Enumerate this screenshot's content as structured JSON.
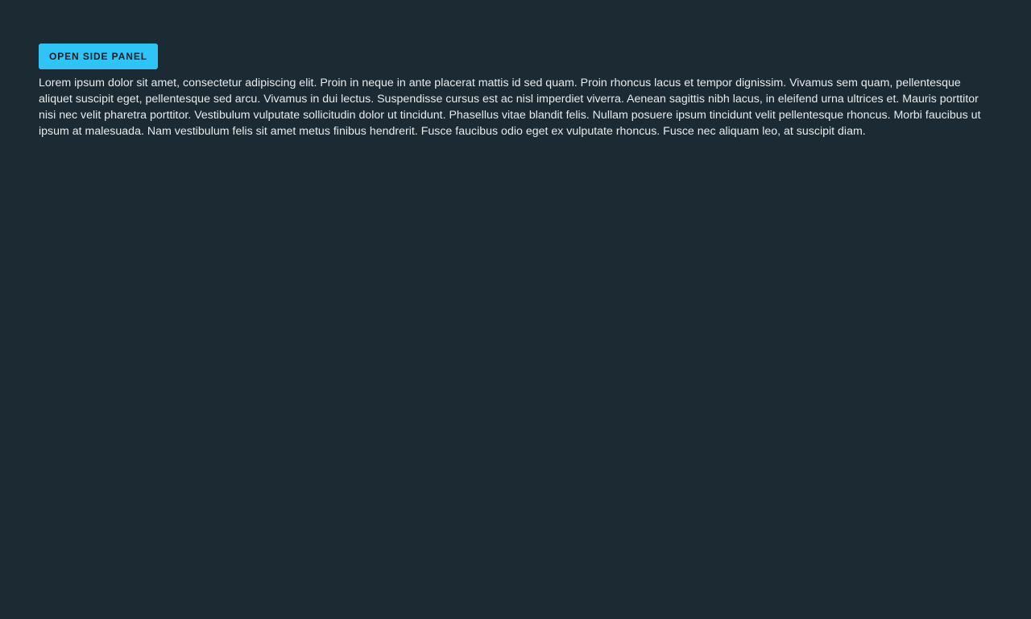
{
  "main": {
    "open_panel_button_label": "OPEN SIDE PANEL",
    "paragraph": "Lorem ipsum dolor sit amet, consectetur adipiscing elit. Proin in neque in ante placerat mattis id sed quam. Proin rhoncus lacus et tempor dignissim. Vivamus sem quam, pellentesque aliquet suscipit eget, pellentesque sed arcu. Vivamus in dui lectus. Suspendisse cursus est ac nisl imperdiet viverra. Aenean sagittis nibh lacus, in eleifend urna ultrices et. Mauris porttitor nisi nec velit pharetra porttitor. Vestibulum vulputate sollicitudin dolor ut tincidunt. Phasellus vitae blandit felis. Nullam posuere ipsum tincidunt velit pellentesque rhoncus. Morbi faucibus ut ipsum at malesuada. Nam vestibulum felis sit amet metus finibus hendrerit. Fusce faucibus odio eget ex vulputate rhoncus. Fusce nec aliquam leo, at suscipit diam."
  },
  "colors": {
    "background": "#1b2a33",
    "accent": "#2ec4f5",
    "text": "#e6ebee"
  }
}
